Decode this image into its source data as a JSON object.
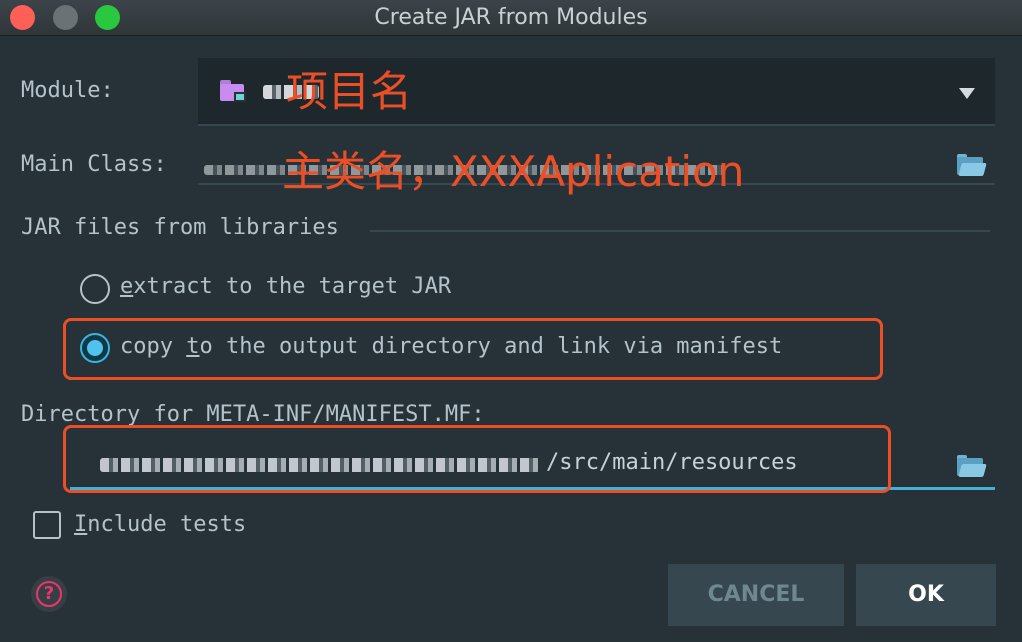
{
  "window": {
    "title": "Create JAR from Modules"
  },
  "module": {
    "label": "Module:",
    "dropdown_icon": "chevron-down-icon"
  },
  "main_class": {
    "label": "Main Class:",
    "browse_icon": "folder-open-icon"
  },
  "jar_libs": {
    "section_title": "JAR files from libraries",
    "option_extract": {
      "mnemonic": "e",
      "rest": "xtract to the target JAR",
      "selected": false
    },
    "option_copy": {
      "before": "copy ",
      "mnemonic": "t",
      "after": "o the output directory and link via manifest",
      "selected": true
    }
  },
  "manifest_dir": {
    "label": "Directory for META-INF/MANIFEST.MF:",
    "value_visible": "/src/main/resources",
    "browse_icon": "folder-open-icon"
  },
  "include_tests": {
    "mnemonic": "I",
    "rest": "nclude tests",
    "checked": false
  },
  "help": {
    "icon": "help-icon",
    "glyph": "?"
  },
  "buttons": {
    "cancel": "CANCEL",
    "ok": "OK"
  },
  "annotations": {
    "module_note": "项目名",
    "main_class_note": "主类名，XXXAplication"
  },
  "colors": {
    "accent": "#43b0d8",
    "annotation": "#ec4f26",
    "background": "#263238"
  }
}
